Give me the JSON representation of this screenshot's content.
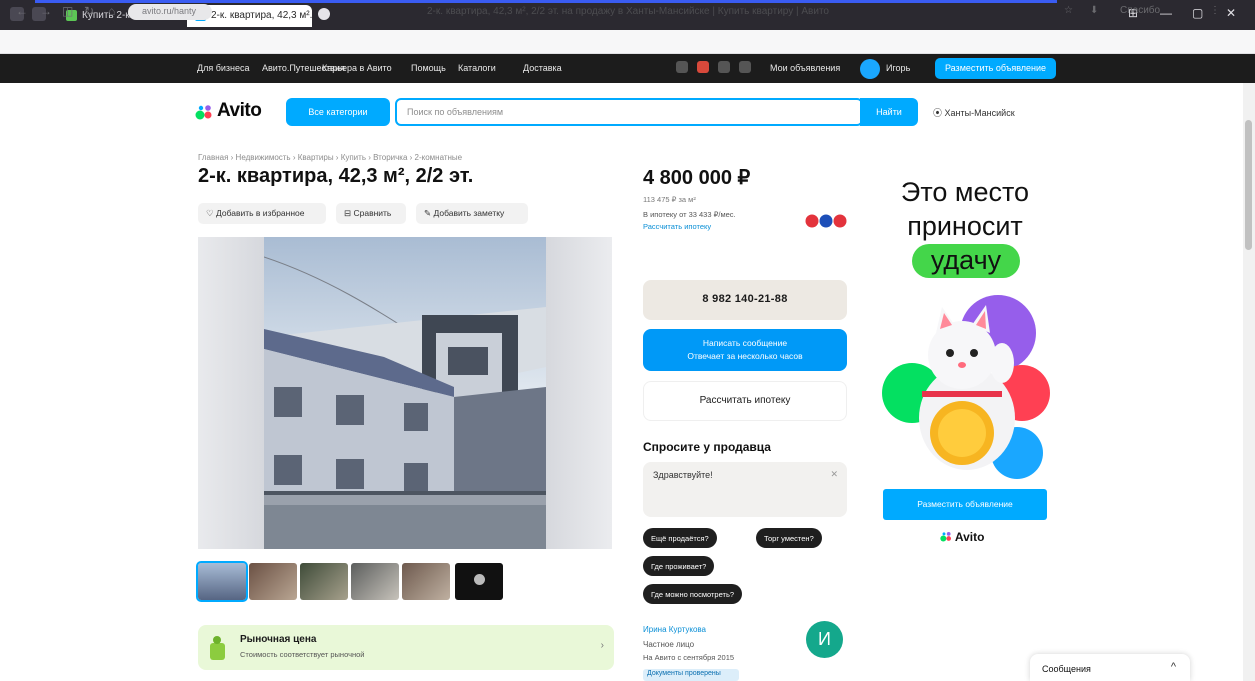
{
  "browser": {
    "tabs": [
      {
        "label": "Купить 2-комнатную кв..."
      },
      {
        "label": "2-к. квартира, 42,3 м²..."
      }
    ],
    "window_controls": [
      "—",
      "▢",
      "✕"
    ],
    "address": {
      "chip": "avito.ru/hanty",
      "title": "2-к. квартира, 42,3 м², 2/2 эт. на продажу в Ханты-Мансийске | Купить квартиру | Авито"
    },
    "right_tools": [
      "☆",
      "⬇",
      "Спасибо",
      "⋮"
    ]
  },
  "topbar": {
    "links": [
      "Для бизнеса",
      "Авито.Путешествия",
      "Карьера в Авито",
      "Помощь",
      "Каталоги",
      "Доставка"
    ],
    "my_ads": "Мои объявления",
    "user": "Игорь",
    "post_button": "Разместить объявление"
  },
  "header": {
    "logo": "Avito",
    "all_categories": "Все категории",
    "search_placeholder": "Поиск по объявлениям",
    "find_button": "Найти",
    "location": "Ханты-Мансийск"
  },
  "listing": {
    "breadcrumb": "Главная › Недвижимость › Квартиры › Купить › Вторичка › 2-комнатные",
    "title": "2-к. квартира, 42,3 м², 2/2 эт.",
    "actions": [
      "Добавить в избранное",
      "Сравнить",
      "Добавить заметку"
    ],
    "banner_title": "Рыночная цена",
    "banner_sub": "Стоимость соответствует рыночной"
  },
  "sidebar": {
    "price": "4 800 000 ₽",
    "price_per_m2": "113 475 ₽ за м²",
    "mortgage": "В ипотеку от 33 433 ₽/мес.",
    "mortgage_link": "Рассчитать ипотеку",
    "phone": "8 982 140-21-88",
    "message_line1": "Написать сообщение",
    "message_line2": "Отвечает за несколько часов",
    "calc_mortgage": "Рассчитать ипотеку",
    "ask_title": "Спросите у продавца",
    "ask_input": "Здравствуйте!",
    "ask_clear": "✕",
    "chips": [
      "Ещё продаётся?",
      "Торг уместен?",
      "Где можно посмотреть?",
      "Где проживает?"
    ],
    "seller_name": "Ирина Куртукова",
    "seller_type": "Частное лицо",
    "seller_since": "На Авито с сентября 2015",
    "seller_badge": "Документы проверены",
    "seller_initial": "И"
  },
  "ad": {
    "line1": "Это место",
    "line2": "приносит",
    "highlight": "удачу",
    "button": "Разместить объявление",
    "logo": "Avito"
  },
  "chat": {
    "label": "Сообщения",
    "chevron": "^"
  },
  "colors": {
    "accent": "#00aaff",
    "dark": "#1c1c1c",
    "green": "#44d64a"
  }
}
